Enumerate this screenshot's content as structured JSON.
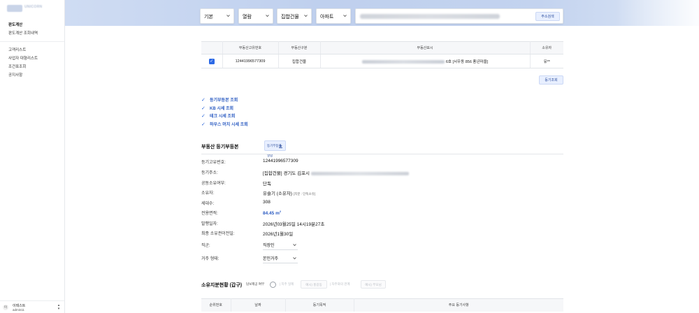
{
  "sidebar": {
    "logo_text": "UNICORN",
    "logo_sub": "",
    "items_top": [
      "판도계산",
      "판도계산 조회내역"
    ],
    "items_main": [
      "고객리스트",
      "사업자 대형리스트",
      "조건표조회",
      "공지사항"
    ],
    "user": {
      "avatar": "이",
      "name": "이테스트",
      "id": "admin11"
    }
  },
  "search": {
    "selects": [
      "기본",
      "열람",
      "집합건물",
      "아파트"
    ],
    "address_button": "주소검색"
  },
  "result_table": {
    "headers": [
      "",
      "부동산고유번호",
      "부동산구분",
      "부동산표시",
      "소유자"
    ],
    "row": {
      "id": "12441996577309",
      "type": "집합건물",
      "address_suffix": "6호 [서우동 856 풍년마을]",
      "owner": "유**"
    }
  },
  "registry_button": "등기조회",
  "checklist": [
    "등기부등본 조회",
    "KB 시세 조회",
    "테크 시세 조회",
    "하우스 머치 시세 조회"
  ],
  "section": {
    "title": "부동산 등기부등본",
    "download_button": "등기부등본 열람",
    "fields": [
      {
        "key": "등기고유번호:",
        "value": "12441996577309"
      },
      {
        "key": "등기주소:",
        "value": "[집합건물] 경기도 김포시"
      },
      {
        "key": "공동소유여부:",
        "value": "단독"
      },
      {
        "key": "소유자:",
        "value": "유슬기 (소유자)",
        "note": "[지분 : 단독소유]"
      },
      {
        "key": "세대수:",
        "value": "308"
      },
      {
        "key": "전용면적:",
        "value": "84.45 m",
        "unit_sup": "2"
      },
      {
        "key": "발행일자:",
        "value": "2026년03월25일 14시19분27초"
      },
      {
        "key": "최종 소유권이전일:",
        "value": "2026년1월30일"
      }
    ],
    "job": {
      "key": "직군:",
      "value": "직장인"
    },
    "residence": {
      "key": "거주 형태:",
      "value": "본인거주"
    }
  },
  "ownership": {
    "title": "소유지분현황 (갑구)",
    "option_label": "담보제공 여부",
    "faded": [
      "| 지주 일례",
      "예시) 홍길동",
      "| 차주와의 관계",
      "예시) 부모님"
    ],
    "headers": [
      "순위번호",
      "날짜",
      "등기목적",
      "주요 등기사항"
    ]
  },
  "colors": {
    "accent": "#2d6ae6",
    "link_blue": "#2b5bc2",
    "header_gradient": "#bfd0ee"
  }
}
